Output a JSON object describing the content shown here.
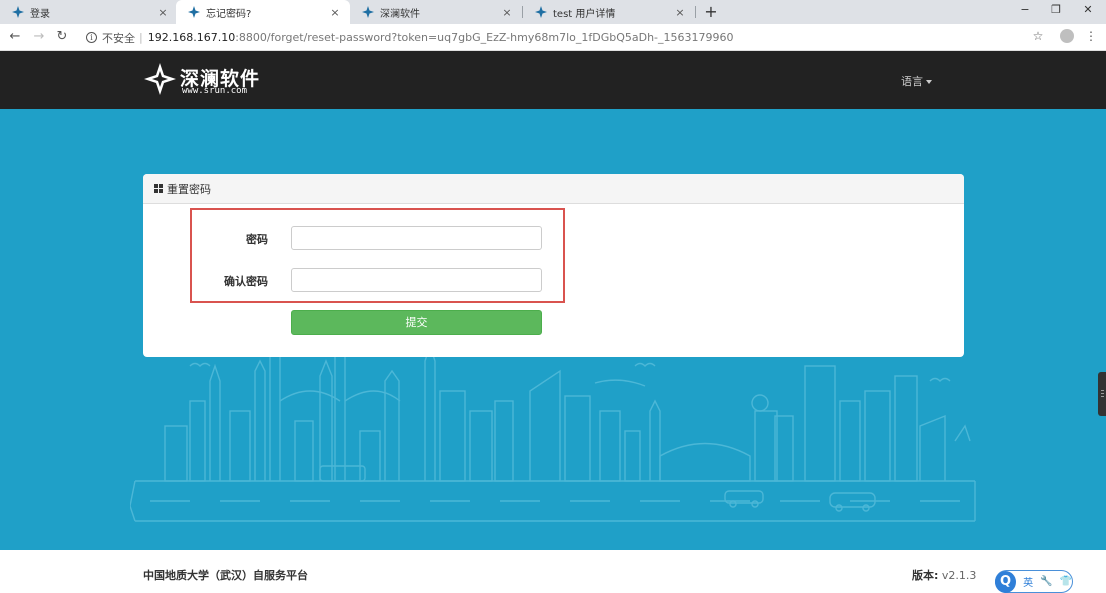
{
  "browser": {
    "tabs": [
      {
        "title": "登录",
        "close": "×"
      },
      {
        "title": "忘记密码?",
        "close": "×"
      },
      {
        "title": "深澜软件",
        "close": "×"
      },
      {
        "title": "test 用户详情",
        "close": "×"
      }
    ],
    "new_tab": "+",
    "window_controls": {
      "minimize": "−",
      "restore": "❐",
      "close": "✕"
    },
    "nav": {
      "back": "←",
      "forward": "→",
      "reload": "↻"
    },
    "security_info": "i",
    "insecure_label": "不安全",
    "url_separator": "|",
    "url_host": "192.168.167.10",
    "url_rest": ":8800/forget/reset-password?token=uq7gbG_EzZ-hmy68m7lo_1fDGbQ5aDh-_1563179960",
    "bookmark_star": "☆",
    "menu_dots": "⋮"
  },
  "header": {
    "logo_name": "深澜软件",
    "logo_url": "www.srun.com",
    "language_menu": "语言"
  },
  "panel": {
    "title": "重置密码",
    "fields": [
      {
        "label": "密码",
        "value": ""
      },
      {
        "label": "确认密码",
        "value": ""
      }
    ],
    "submit_label": "提交"
  },
  "footer": {
    "org_name": "中国地质大学（武汉）自服务平台",
    "version_label": "版本:",
    "version_value": "v2.1.3"
  },
  "ime_toolbar": {
    "logo": "Q",
    "mode": "英",
    "tool": "🔧",
    "skin": "👕"
  },
  "colors": {
    "header_bg": "#222222",
    "main_bg": "#1fa0c8",
    "submit_green": "#5cb85c",
    "highlight_red": "#d9534f"
  }
}
